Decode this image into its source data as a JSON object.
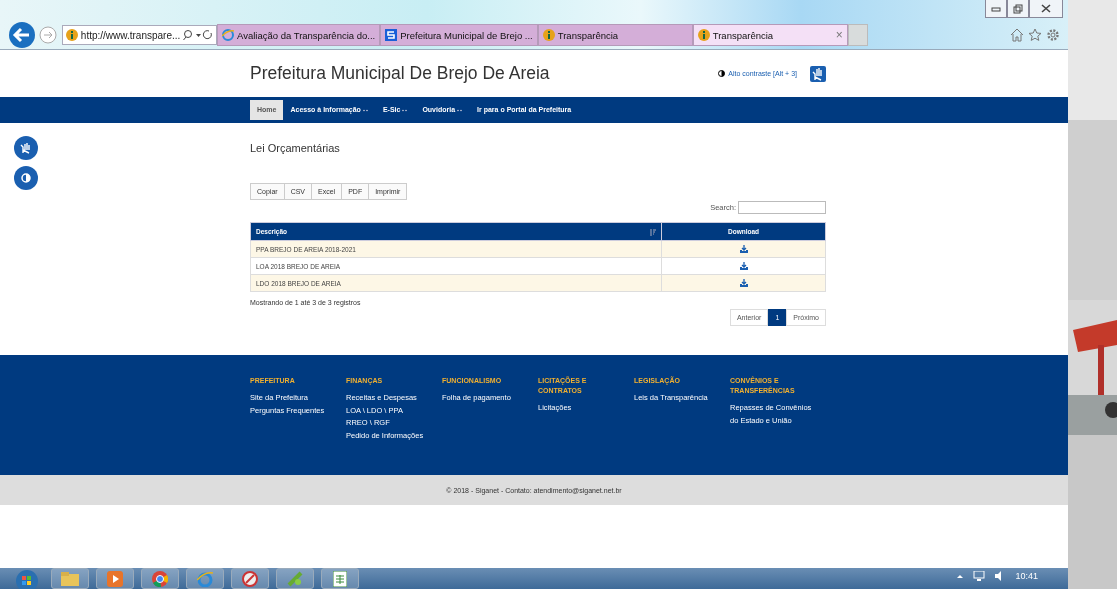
{
  "browser": {
    "address": "http://www.transpare...",
    "tabs": [
      {
        "title": "Avaliação da Transparência do...",
        "kind": "ie",
        "selected": false
      },
      {
        "title": "Prefeitura Municipal de Brejo ...",
        "kind": "s",
        "selected": false
      },
      {
        "title": "Transparência",
        "kind": "info",
        "selected": false
      },
      {
        "title": "Transparência",
        "kind": "info",
        "selected": true
      }
    ],
    "close_glyph": "×"
  },
  "header": {
    "site_title": "Prefeitura Municipal De Brejo De Areia",
    "contrast_link": "Alto contraste [Alt + 3]"
  },
  "nav": [
    {
      "label": "Home",
      "selected": true,
      "has_menu": false
    },
    {
      "label": "Acesso à Informação",
      "selected": false,
      "has_menu": true
    },
    {
      "label": "E-Sic",
      "selected": false,
      "has_menu": true
    },
    {
      "label": "Ouvidoria",
      "selected": false,
      "has_menu": true
    },
    {
      "label": "Ir para o Portal da Prefeitura",
      "selected": false,
      "has_menu": false
    }
  ],
  "heading": "Lei Orçamentárias",
  "export_buttons": [
    "Copiar",
    "CSV",
    "Excel",
    "PDF",
    "Imprimir"
  ],
  "search": {
    "label": "Search:"
  },
  "table": {
    "columns": [
      "Descrição",
      "Download"
    ],
    "rows": [
      {
        "description": "PPA BREJO DE AREIA 2018-2021"
      },
      {
        "description": "LOA 2018 BREJO DE AREIA"
      },
      {
        "description": "LDO 2018 BREJO DE AREIA"
      }
    ]
  },
  "info": "Mostrando de 1 até 3 de 3 registros",
  "pagination": [
    {
      "label": "Anterior",
      "selected": false
    },
    {
      "label": "1",
      "selected": true
    },
    {
      "label": "Próximo",
      "selected": false
    }
  ],
  "footer": {
    "columns": [
      {
        "heading": "PREFEITURA",
        "links": [
          "Site da Prefeitura",
          "Perguntas Frequentes"
        ]
      },
      {
        "heading": "FINANÇAS",
        "links": [
          "Receitas e Despesas",
          "LOA \\ LDO \\ PPA",
          "RREO \\ RGF",
          "Pedido de Informações"
        ]
      },
      {
        "heading": "FUNCIONALISMO",
        "links": [
          "Folha de pagamento"
        ]
      },
      {
        "heading": "LICITAÇÕES E CONTRATOS",
        "links": [
          "Licitações"
        ]
      },
      {
        "heading": "LEGISLAÇÃO",
        "links": [
          "Leis da Transparência"
        ]
      },
      {
        "heading": "CONVÊNIOS E TRANSFERÊNCIAS",
        "links": [
          "Repasses de Convênios do Estado e União"
        ]
      }
    ],
    "copyright": "© 2018 - Siganet - Contato: atendimento@siganet.net.br"
  },
  "taskbar": {
    "clock": "10:41"
  }
}
